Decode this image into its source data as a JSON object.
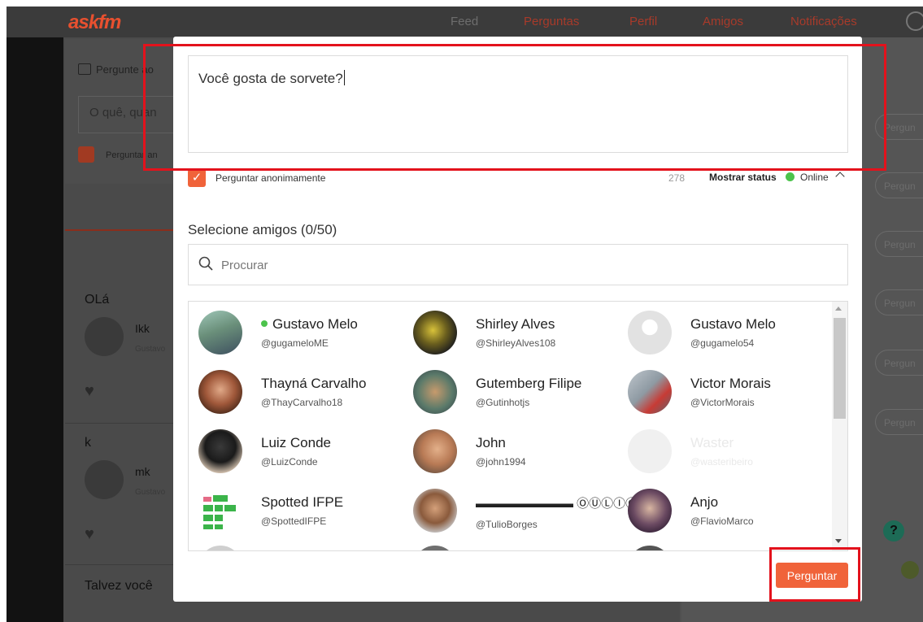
{
  "nav": {
    "logo": "askfm",
    "links": [
      "Feed",
      "Perguntas",
      "Perfil",
      "Amigos",
      "Notificações"
    ]
  },
  "background": {
    "ask_label": "Pergunte ao",
    "ask_placeholder": "O quê, quan",
    "ask_anon": "Perguntar an",
    "posts": [
      {
        "title": "OLá",
        "user": "Ikk",
        "sub": "Gustavo"
      },
      {
        "title": "k",
        "user": "mk",
        "sub": "Gustavo"
      }
    ],
    "talvez": "Talvez você",
    "right_buttons": [
      "Pergun",
      "Pergun",
      "Pergun",
      "Pergun",
      "Pergun",
      "Pergun"
    ],
    "help": "?"
  },
  "modal": {
    "question": "Você gosta de sorvete?",
    "anon_label": "Perguntar anonimamente",
    "char_count": "278",
    "show_status": "Mostrar status",
    "online_label": "Online",
    "select_title": "Selecione amigos (0/50)",
    "search_placeholder": "Procurar",
    "friends": [
      {
        "name": "Gustavo Melo",
        "handle": "@gugameloME",
        "online": true
      },
      {
        "name": "Shirley Alves",
        "handle": "@ShirleyAlves108"
      },
      {
        "name": "Gustavo Melo",
        "handle": "@gugamelo54"
      },
      {
        "name": "Thayná Carvalho",
        "handle": "@ThayCarvalho18"
      },
      {
        "name": "Gutemberg Filipe",
        "handle": "@Gutinhotjs"
      },
      {
        "name": "Victor Morais",
        "handle": "@VictorMorais"
      },
      {
        "name": "Luiz Conde",
        "handle": "@LuizConde"
      },
      {
        "name": "John",
        "handle": "@john1994"
      },
      {
        "name": "Waster",
        "handle": "@wasteribeiro",
        "disabled": true
      },
      {
        "name": "Spotted IFPE",
        "handle": "@SpottedIFPE"
      },
      {
        "name": "▬▬▬▬▬▬▬▬ ⓄⓊⓁⒾⓄ ...",
        "handle": "@TulioBorges"
      },
      {
        "name": "Anjo",
        "handle": "@FlavioMarco"
      }
    ],
    "submit_label": "Perguntar"
  },
  "colors": {
    "accent": "#f0633a",
    "online": "#4cc34c",
    "highlight": "#e3121c"
  }
}
